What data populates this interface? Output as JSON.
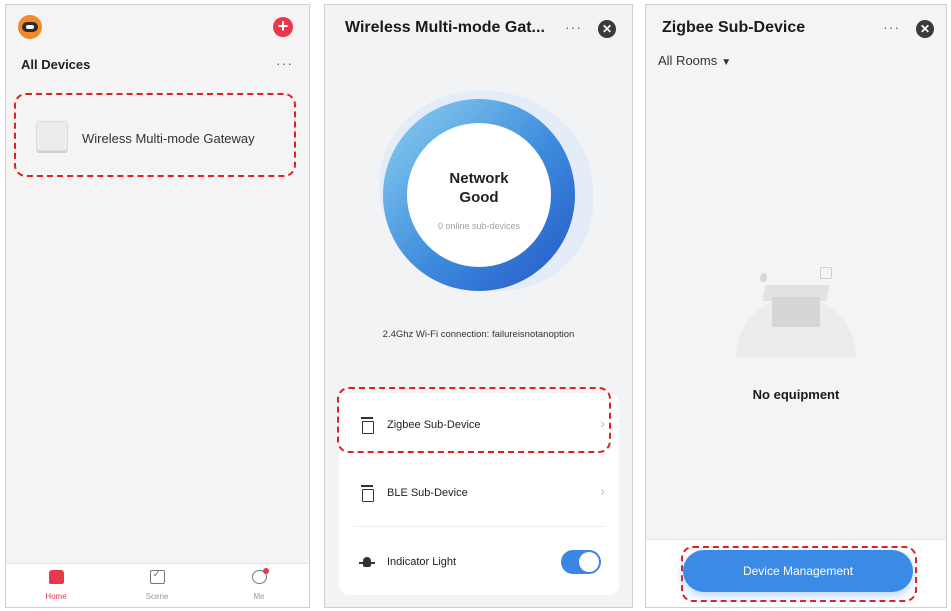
{
  "colors": {
    "accent_red": "#e8384b",
    "highlight_red": "#e02020",
    "primary_blue": "#3b8ae6",
    "ring_start": "#8fd2f2",
    "ring_end": "#2456c8"
  },
  "home_screen": {
    "logo_icon": "robot-logo-icon",
    "add_icon": "plus-circle-icon",
    "section_title": "All Devices",
    "more_label": "···",
    "devices": [
      {
        "name": "Wireless Multi-mode Gateway",
        "icon": "gateway-device-icon"
      }
    ],
    "tabbar": [
      {
        "label": "Home",
        "icon": "home-icon"
      },
      {
        "label": "Scene",
        "icon": "scene-check-icon"
      },
      {
        "label": "Me",
        "icon": "user-icon"
      }
    ]
  },
  "gateway_screen": {
    "title": "Wireless Multi-mode Gat...",
    "more_label": "···",
    "close_label": "✕",
    "network_status_line1": "Network",
    "network_status_line2": "Good",
    "sub_devices_online": "0 online sub-devices",
    "wifi_info": "2.4Ghz Wi-Fi connection: failureisnotanoption",
    "rows": [
      {
        "label": "Zigbee Sub-Device",
        "icon": "zigbee-hub-icon"
      },
      {
        "label": "BLE Sub-Device",
        "icon": "ble-hub-icon"
      },
      {
        "label": "Indicator Light",
        "icon": "bulb-icon"
      }
    ],
    "indicator_light_on": true
  },
  "zigbee_screen": {
    "title": "Zigbee Sub-Device",
    "more_label": "···",
    "close_label": "✕",
    "rooms_filter": "All Rooms",
    "empty_text": "No equipment",
    "empty_icon": "empty-box-icon",
    "action_button": "Device Management"
  }
}
